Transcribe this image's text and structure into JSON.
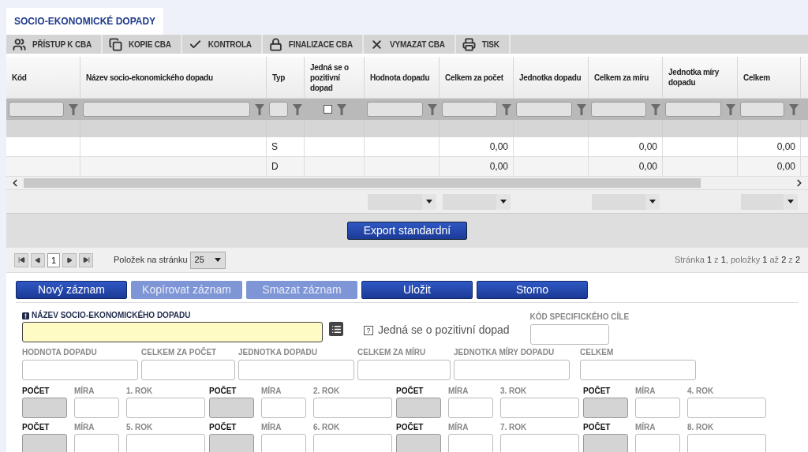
{
  "tab": {
    "label": "SOCIO-EKONOMICKÉ DOPADY",
    "selected": true
  },
  "toolbar": [
    {
      "label": "PŘÍSTUP K CBA",
      "kind": "people"
    },
    {
      "label": "KOPIE CBA",
      "kind": "copy"
    },
    {
      "label": "KONTROLA",
      "kind": "check"
    },
    {
      "label": "FINALIZACE CBA",
      "kind": "lock"
    },
    {
      "label": "VYMAZAT CBA",
      "kind": "delete"
    },
    {
      "label": "TISK",
      "kind": "print"
    }
  ],
  "table": {
    "columns": [
      {
        "label": "Kód",
        "kind": "text",
        "aggregate": false
      },
      {
        "label": "Název socio-ekonomického dopadu",
        "kind": "text",
        "aggregate": false
      },
      {
        "label": "Typ",
        "kind": "text",
        "aggregate": false
      },
      {
        "label": "Jedná se o pozitivní dopad",
        "kind": "checkbox",
        "checked": false,
        "aggregate": false
      },
      {
        "label": "Hodnota dopadu",
        "kind": "text",
        "aggregate": true
      },
      {
        "label": "Celkem za počet",
        "kind": "text",
        "aggregate": true
      },
      {
        "label": "Jednotka dopadu",
        "kind": "text",
        "aggregate": false
      },
      {
        "label": "Celkem za míru",
        "kind": "text",
        "aggregate": true
      },
      {
        "label": "Jednotka míry dopadu",
        "kind": "text",
        "aggregate": false
      },
      {
        "label": "Celkem",
        "kind": "text",
        "aggregate": true
      }
    ],
    "rows": [
      [
        null,
        null,
        "S",
        null,
        null,
        "0,00",
        null,
        "0,00",
        null,
        "0,00"
      ],
      [
        null,
        null,
        "D",
        null,
        null,
        "0,00",
        null,
        "0,00",
        null,
        "0,00"
      ]
    ],
    "export_button": "Export standardní"
  },
  "pager": {
    "page": "1",
    "per_page_label": "Položek na stránku",
    "per_page": "25",
    "summary": "Stránka **1** z **1**, položky **1** až **2** z **2**"
  },
  "actions": [
    {
      "label": "Nový záznam",
      "disabled": false
    },
    {
      "label": "Kopírovat záznam",
      "disabled": true
    },
    {
      "label": "Smazat záznam",
      "disabled": true
    },
    {
      "label": "Uložit",
      "disabled": false
    },
    {
      "label": "Storno",
      "disabled": false
    }
  ],
  "form": {
    "name_field": {
      "label": "NÁZEV SOCIO-EKONOMICKÉHO DOPADU",
      "required": true
    },
    "positive": {
      "icon": "?",
      "label": "Jedná se o pozitivní dopad"
    },
    "specific_goal": {
      "label": "KÓD SPECIFICKÉHO CÍLE"
    },
    "fields": [
      "HODNOTA DOPADU",
      "CELKEM ZA POČET",
      "JEDNOTKA DOPADU",
      "CELKEM ZA MÍRU",
      "JEDNOTKA MÍRY DOPADU",
      "CELKEM"
    ],
    "years": [
      {
        "count": "POČET",
        "measure": "MÍRA",
        "year": "1. ROK"
      },
      {
        "count": "POČET",
        "measure": "MÍRA",
        "year": "2. ROK"
      },
      {
        "count": "POČET",
        "measure": "MÍRA",
        "year": "3. ROK"
      },
      {
        "count": "POČET",
        "measure": "MÍRA",
        "year": "4. ROK"
      },
      {
        "count": "POČET",
        "measure": "MÍRA",
        "year": "5. ROK"
      },
      {
        "count": "POČET",
        "measure": "MÍRA",
        "year": "6. ROK"
      },
      {
        "count": "POČET",
        "measure": "MÍRA",
        "year": "7. ROK"
      },
      {
        "count": "POČET",
        "measure": "MÍRA",
        "year": "8. ROK"
      }
    ]
  }
}
